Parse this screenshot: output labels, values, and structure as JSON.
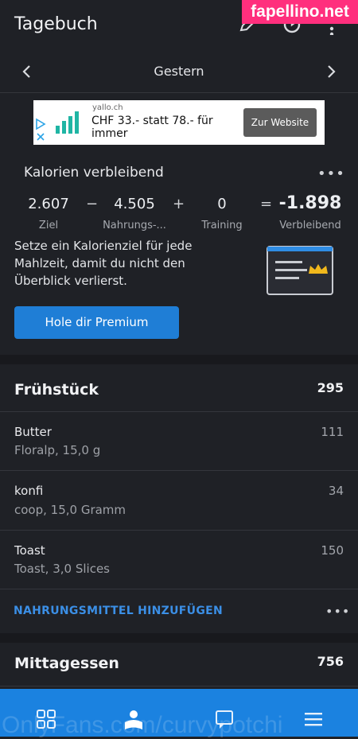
{
  "header": {
    "title": "Tagebuch",
    "watermark": "fapellino.net"
  },
  "date_nav": {
    "label": "Gestern"
  },
  "ad": {
    "source": "yallo.ch",
    "headline": "CHF 33.- statt 78.- für immer",
    "cta": "Zur Website"
  },
  "calories": {
    "title": "Kalorien verbleibend",
    "goal": "2.607",
    "goal_label": "Ziel",
    "food": "4.505",
    "food_label": "Nahrungs-...",
    "exercise": "0",
    "exercise_label": "Training",
    "remaining": "-1.898",
    "remaining_label": "Verbleibend",
    "op_minus": "−",
    "op_plus": "+",
    "op_equals": "="
  },
  "premium": {
    "text_line1": "Setze ein Kalorienziel für jede",
    "text_line2": "Mahlzeit, damit du nicht den",
    "text_line3": "Überblick verlierst.",
    "button": "Hole dir Premium"
  },
  "meals": {
    "breakfast": {
      "title": "Frühstück",
      "total": "295",
      "items": [
        {
          "name": "Butter",
          "detail": "Floralp, 15,0 g",
          "kcal": "111"
        },
        {
          "name": "konfi",
          "detail": "coop, 15,0 Gramm",
          "kcal": "34"
        },
        {
          "name": "Toast",
          "detail": "Toast, 3,0 Slices",
          "kcal": "150"
        }
      ],
      "add_label": "NAHRUNGSMITTEL HINZUFÜGEN"
    },
    "lunch": {
      "title": "Mittagessen",
      "total": "756"
    }
  },
  "overlay_text": "OnlyFans.com/curvypotchi",
  "colors": {
    "background": "#1f2126",
    "accent": "#1f7ed6",
    "link": "#3b8fe6"
  }
}
